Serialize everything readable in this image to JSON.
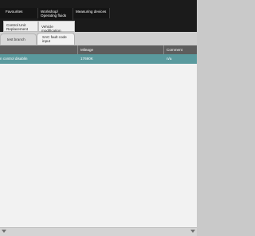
{
  "nav": {
    "top_items": [
      "Favourites",
      "Workshop/ Operating fluids",
      "Measuring devices"
    ],
    "second_items": [
      "Control Unit Replacement",
      "Vehicle modification"
    ]
  },
  "tabs": [
    "test branch",
    "SAC fault code input"
  ],
  "table": {
    "headers": [
      "",
      "Mileage",
      "Comment"
    ],
    "rows": [
      [
        "n control disablin",
        "17690K",
        "n/a"
      ]
    ]
  },
  "colors": {
    "topbar": "#1b1b1b",
    "header": "#5d5d5d",
    "selected_row": "#5a9a9e",
    "list_bg": "#f2f2f2"
  }
}
